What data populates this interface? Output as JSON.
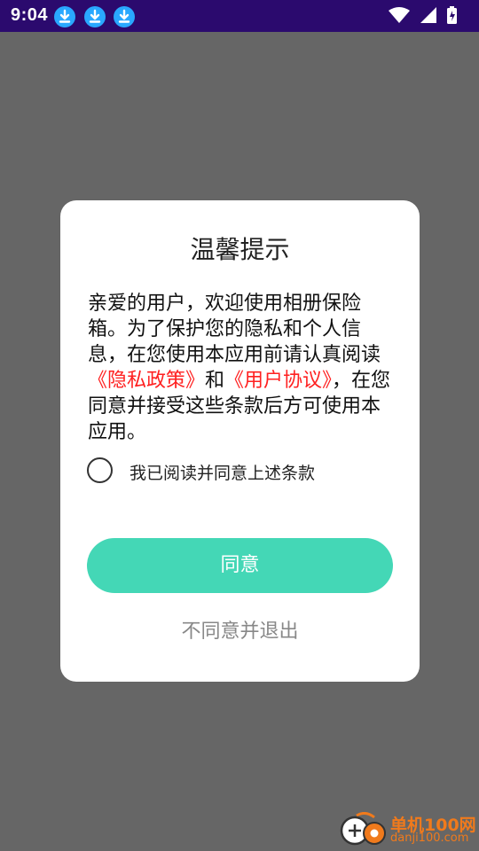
{
  "status_bar": {
    "time": "9:04"
  },
  "dialog": {
    "title": "温馨提示",
    "message_part1": "亲爱的用户，欢迎使用相册保险箱。为了保护您的隐私和个人信息，在您使用本应用前请认真阅读",
    "privacy_link": "《隐私政策》",
    "message_and": "和",
    "user_agreement_link": "《用户协议》",
    "message_part2": "，在您同意并接受这些条款后方可使用本应用。",
    "checkbox_label": "我已阅读并同意上述条款",
    "agree_button": "同意",
    "decline_button": "不同意并退出"
  },
  "watermark": {
    "name": "单机100网",
    "url": "danji100.com"
  },
  "colors": {
    "status_bar": "#2b0a6e",
    "overlay": "#666666",
    "accent": "#44d7b6",
    "link": "#ff2020",
    "watermark": "#f07a1c"
  }
}
